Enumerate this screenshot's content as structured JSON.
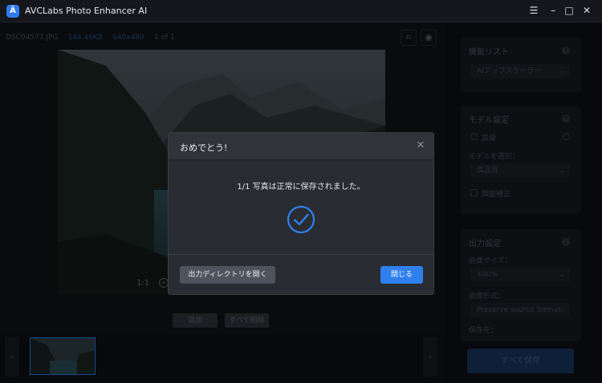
{
  "app": {
    "title": "AVCLabs Photo Enhancer AI",
    "logo_glyph": "Ā"
  },
  "window_controls": {
    "menu": "☰",
    "minimize": "–",
    "maximize": "□",
    "close": "✕"
  },
  "file": {
    "name": "DSC04577.JPG",
    "size": "144.46KB",
    "dimensions": "640x480",
    "page": "1 of 1"
  },
  "preview": {
    "zoom_label": "1:1"
  },
  "buttons": {
    "add": "追加",
    "clear_all": "すべて削除"
  },
  "sidebar": {
    "feature_list": {
      "title": "機能リスト",
      "selected": "AIアップスケーラー"
    },
    "model_settings": {
      "title": "モデル設定",
      "quality_label": "高級",
      "select_model_label": "モデルを選択：",
      "select_model_value": "高品質",
      "face_correction_label": "顔面補正"
    },
    "output_settings": {
      "title": "出力設定",
      "image_size_label": "画像サイズ：",
      "image_size_value": "400%",
      "image_format_label": "画像形式：",
      "image_format_value": "Preserve source format",
      "save_to_label": "保存先："
    },
    "save_all": "すべて保存"
  },
  "dialog": {
    "title": "おめでとう!",
    "message": "1/1 写真は正常に保存されました。",
    "open_dir_button": "出力ディレクトリを開く",
    "close_button": "閉じる"
  },
  "colors": {
    "accent": "#2F80ED",
    "dialog_bg": "#292C32"
  }
}
